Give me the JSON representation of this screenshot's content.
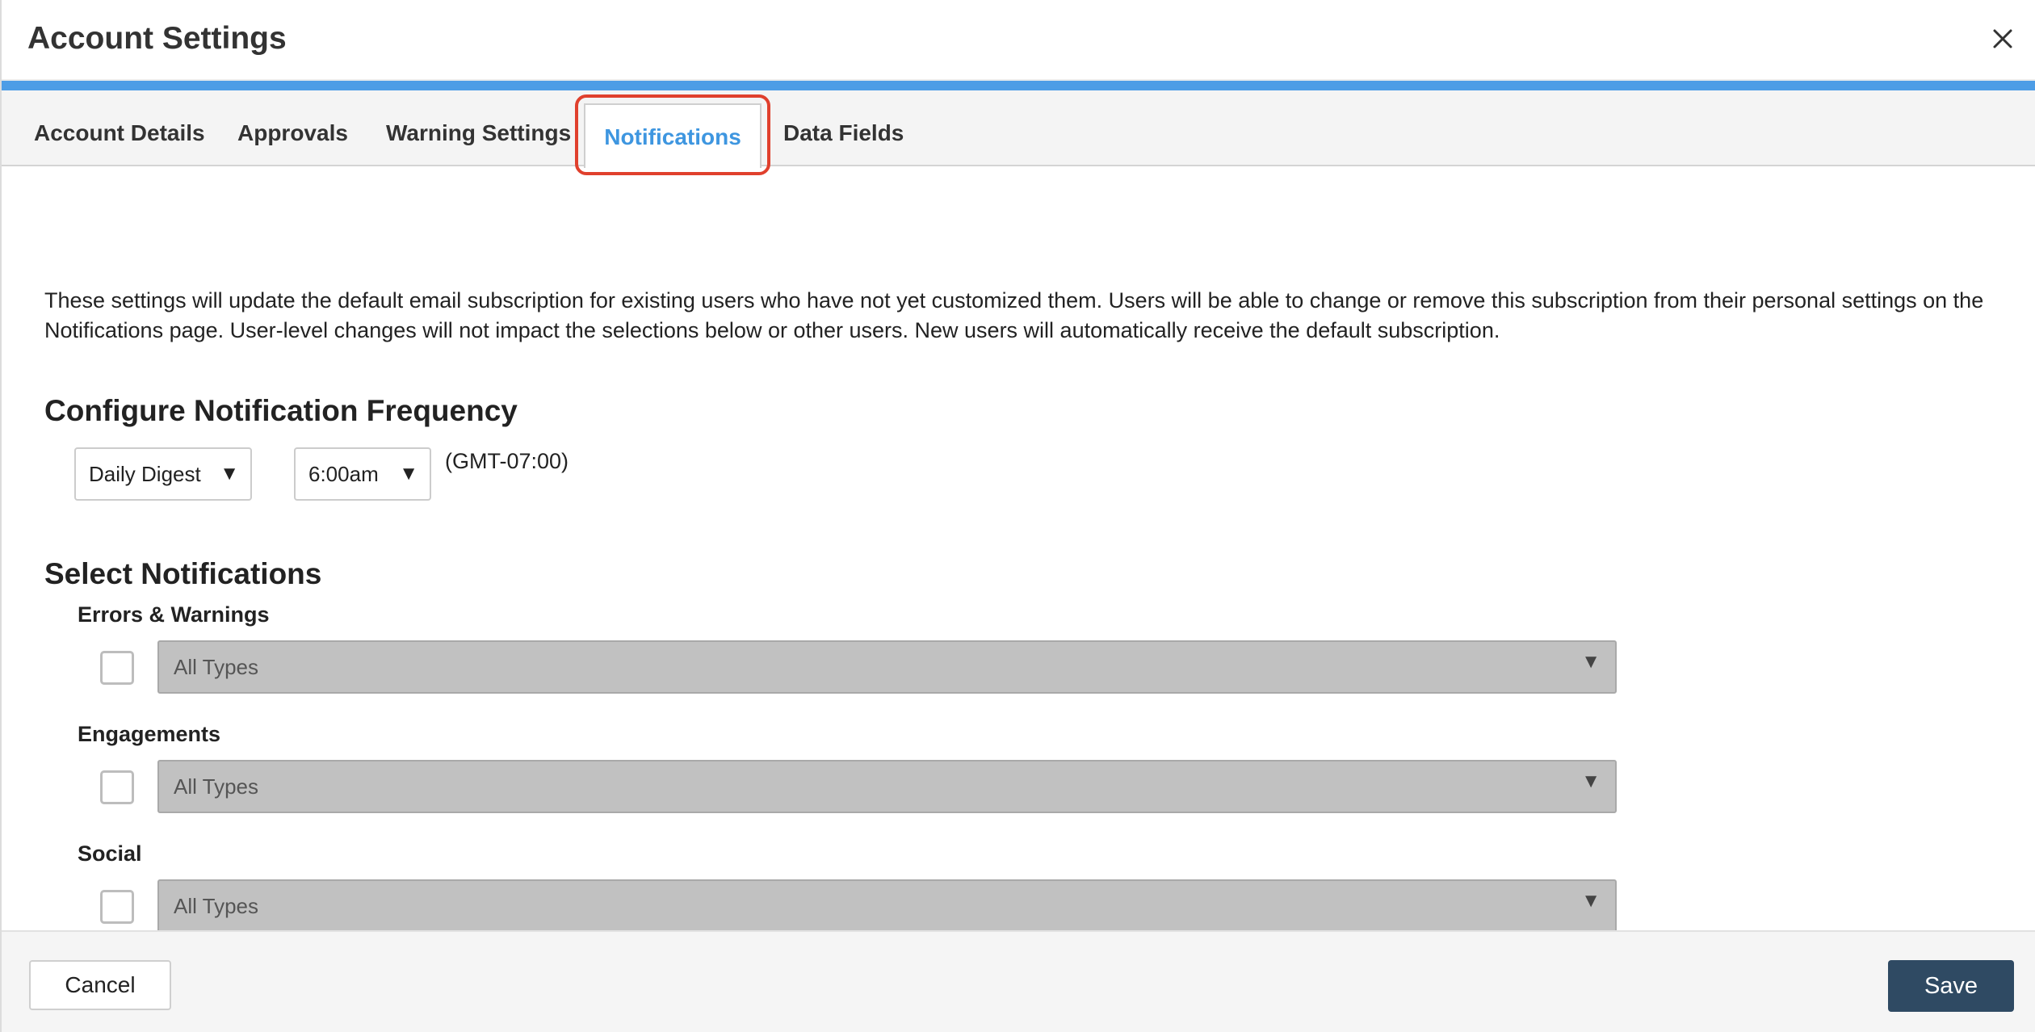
{
  "modal": {
    "title": "Account Settings",
    "close_icon": "close-icon",
    "accent_color": "#4d9de6"
  },
  "tabs": [
    {
      "label": "Account Details",
      "active": false
    },
    {
      "label": "Approvals",
      "active": false
    },
    {
      "label": "Warning Settings",
      "active": false
    },
    {
      "label": "Notifications",
      "active": true
    },
    {
      "label": "Data Fields",
      "active": false
    }
  ],
  "intro_text": "These settings will update the default email subscription for existing users who have not yet customized them. Users will be able to change or remove this subscription from their personal settings on the Notifications page. User-level changes will not impact the selections below or other users. New users will automatically receive the default subscription.",
  "frequency": {
    "heading": "Configure Notification Frequency",
    "frequency_value": "Daily Digest",
    "time_value": "6:00am",
    "timezone": "(GMT-07:00)"
  },
  "notifications": {
    "heading": "Select Notifications",
    "groups": [
      {
        "label": "Errors & Warnings",
        "checked": false,
        "type_value": "All Types"
      },
      {
        "label": "Engagements",
        "checked": false,
        "type_value": "All Types"
      },
      {
        "label": "Social",
        "checked": false,
        "type_value": "All Types"
      }
    ]
  },
  "footer": {
    "cancel_label": "Cancel",
    "save_label": "Save",
    "save_color": "#2f4a63"
  },
  "colors": {
    "active_tab_text": "#3e96e0",
    "highlight_outline": "#e0402d",
    "disabled_select_bg": "#c1c1c1"
  }
}
